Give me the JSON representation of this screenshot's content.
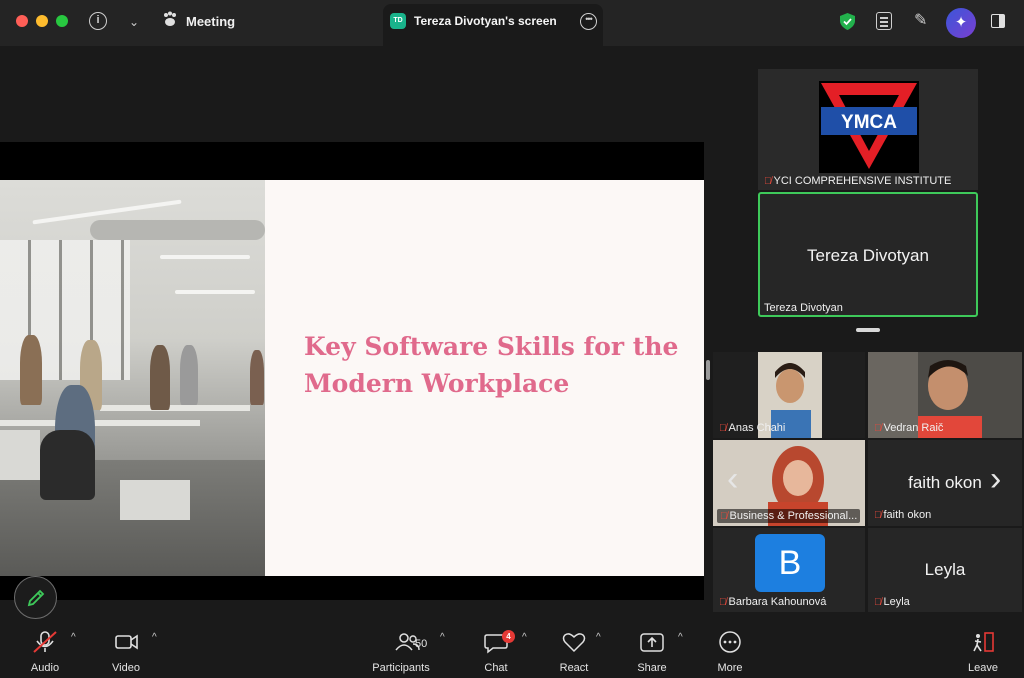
{
  "titlebar": {
    "meeting_label": "Meeting",
    "screen_tab_initials": "TD",
    "screen_tab_label": "Tereza Divotyan's screen"
  },
  "slide": {
    "title_line1": "Key Software Skills for the",
    "title_line2": "Modern Workplace",
    "title_color": "#e06a8c"
  },
  "participants_panel": {
    "host_tile": {
      "logo_text": "YMCA",
      "name": "YCI COMPREHENSIVE INSTITUTE"
    },
    "presenter_tile": {
      "display_name": "Tereza Divotyan",
      "name": "Tereza Divotyan"
    },
    "gallery": [
      {
        "name": "Anas Chahi"
      },
      {
        "name": "Vedran Raič"
      },
      {
        "name": "Business & Professional..."
      },
      {
        "name": "faith okon",
        "display_name": "faith okon"
      },
      {
        "name": "Barbara Kahounová",
        "avatar_letter": "B"
      },
      {
        "name": "Leyla",
        "display_name": "Leyla"
      }
    ]
  },
  "toolbar": {
    "audio": "Audio",
    "video": "Video",
    "participants": "Participants",
    "participants_count": "50",
    "chat": "Chat",
    "chat_badge": "4",
    "react": "React",
    "share": "Share",
    "more": "More",
    "leave": "Leave"
  },
  "colors": {
    "active_speaker_border": "#3ec95a",
    "mute_red": "#e84a3c",
    "avatar_blue": "#1d7fe0"
  }
}
